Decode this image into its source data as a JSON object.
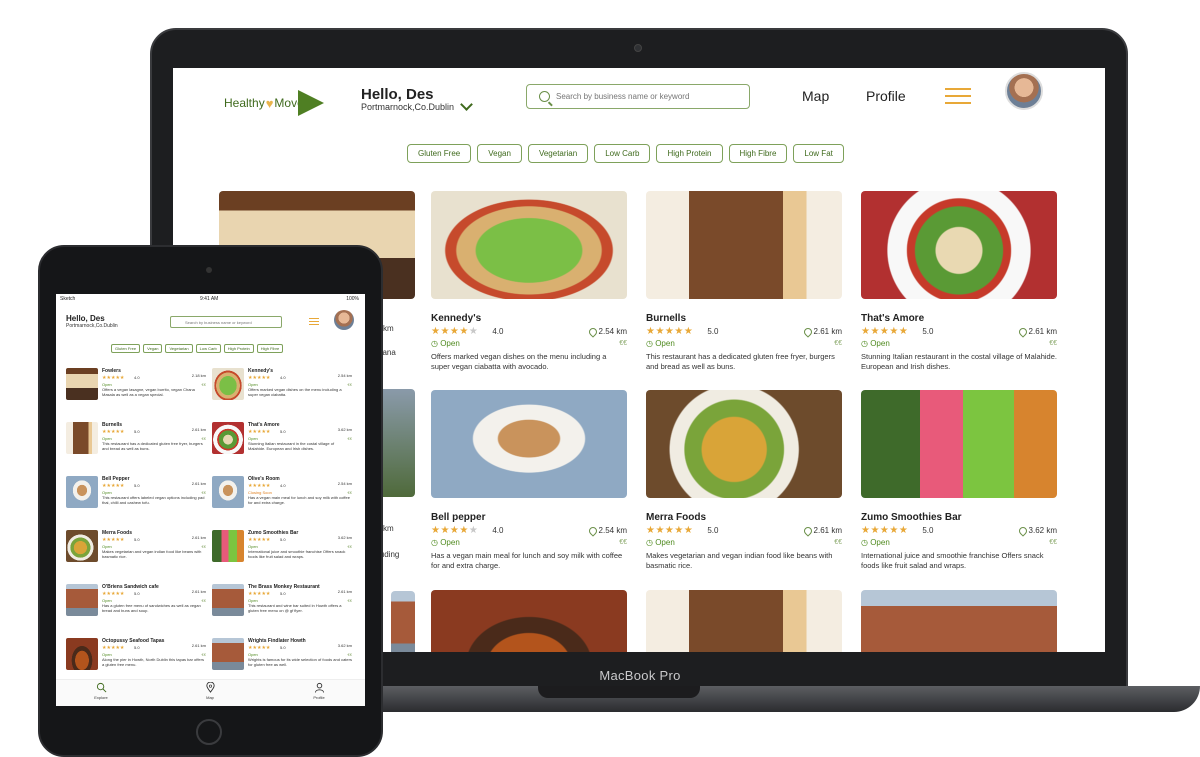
{
  "laptop": {
    "brand_label": "MacBook Pro",
    "app": {
      "logo_text_1": "Healthy",
      "logo_text_2": "Move",
      "greeting": "Hello, Des",
      "location": "Portmarnock,Co.Dublin",
      "search_placeholder": "Search by business name or keyword",
      "nav": [
        "Map",
        "Profile"
      ],
      "filters": [
        "Gluten Free",
        "Vegan",
        "Vegetarian",
        "Low Carb",
        "High Protein",
        "High Fibre",
        "Low Fat"
      ],
      "partial_left": [
        "km",
        "hana",
        "km",
        "luding"
      ],
      "cards": [
        {
          "name": "Kennedy's",
          "stars": 4,
          "rating": "4.0",
          "distance": "2.54 km",
          "status": "Open",
          "price": "€€",
          "desc": "Offers marked vegan dishes on the menu including a super vegan ciabatta with avocado.",
          "photo": "p-kennedy"
        },
        {
          "name": "Burnells",
          "stars": 5,
          "rating": "5.0",
          "distance": "2.61 km",
          "status": "Open",
          "price": "€€",
          "desc": "This restaurant has a dedicated gluten free fryer, burgers and bread as well as buns.",
          "photo": "p-burnells"
        },
        {
          "name": "That's Amore",
          "stars": 5,
          "rating": "5.0",
          "distance": "2.61 km",
          "status": "Open",
          "price": "€€",
          "desc": "Stunning Italian restaurant in the costal village of Malahide. European and Irish dishes.",
          "photo": "p-amore"
        },
        {
          "name": "Bell pepper",
          "stars": 4,
          "rating": "4.0",
          "distance": "2.54 km",
          "status": "Open",
          "price": "€€",
          "desc": "Has a vegan main meal for lunch and soy milk with coffee for and extra charge.",
          "photo": "p-bellpep"
        },
        {
          "name": "Merra Foods",
          "stars": 5,
          "rating": "5.0",
          "distance": "2.61 km",
          "status": "Open",
          "price": "€€",
          "desc": "Makes vegetarian and vegan indian food like beans with basmatic rice.",
          "photo": "p-merra"
        },
        {
          "name": "Zumo Smoothies Bar",
          "stars": 5,
          "rating": "5.0",
          "distance": "3.62 km",
          "status": "Open",
          "price": "€€",
          "desc": "International juice and smoothie franchise Offers snack foods like fruit salad and wraps.",
          "photo": "p-zumo"
        }
      ]
    }
  },
  "tablet": {
    "status_bar": {
      "carrier": "Sketch",
      "time": "9:41 AM",
      "battery": "100%"
    },
    "greeting": "Hello, Des",
    "location": "Portmarnock,Co.Dublin",
    "search_placeholder": "Search by business name or keyword",
    "filters": [
      "Gluten Free",
      "Vegan",
      "Vegetarian",
      "Low Carb",
      "High Protein",
      "High Fibre"
    ],
    "cards": [
      {
        "name": "Fowlers",
        "rating": "4.0",
        "distance": "2.18 km",
        "status": "Open",
        "price": "€€",
        "desc": "Offers a vegan lasagne, vegan burrito, vegan Chana Masala as well as a vegan special.",
        "photo": "p-fowlers"
      },
      {
        "name": "Kennedy's",
        "rating": "4.0",
        "distance": "2.54 km",
        "status": "Open",
        "price": "€€",
        "desc": "Offers marked vegan dishes on the menu including a super vegan ciabatta.",
        "photo": "p-kennedy"
      },
      {
        "name": "Burnells",
        "rating": "5.0",
        "distance": "2.61 km",
        "status": "Open",
        "price": "€€",
        "desc": "This restaurant has a dedicated gluten free fryer, burgers and bread as well as buns.",
        "photo": "p-burnells"
      },
      {
        "name": "That's Amore",
        "rating": "5.0",
        "distance": "3.62 km",
        "status": "Open",
        "price": "€€",
        "desc": "Stunning Italian restaurant in the costal village of Malahide. European and Irish dishes.",
        "photo": "p-amore"
      },
      {
        "name": "Bell Pepper",
        "rating": "5.0",
        "distance": "2.61 km",
        "status": "Open",
        "price": "€€",
        "desc": "This restaurant offers labeled vegan options including pad thai, chilli and cashew tofu.",
        "photo": "p-bellpep"
      },
      {
        "name": "Olive's Room",
        "rating": "4.0",
        "distance": "2.54 km",
        "status": "Closing Soon",
        "price": "€€",
        "desc": "Has a vegan main meal for lunch and soy milk with coffee for and extra charge.",
        "photo": "p-bellpep"
      },
      {
        "name": "Merra Foods",
        "rating": "5.0",
        "distance": "2.61 km",
        "status": "Open",
        "price": "€€",
        "desc": "Makes vegetarian and vegan indian food like beans with basmatic rice.",
        "photo": "p-merra"
      },
      {
        "name": "Zumo Smoothies Bar",
        "rating": "5.0",
        "distance": "3.62 km",
        "status": "Open",
        "price": "€€",
        "desc": "International juice and smoothie franchise Offers snack foods like fruit salad and wraps.",
        "photo": "p-zumo"
      },
      {
        "name": "O'Briens Sandwich cafe",
        "rating": "5.0",
        "distance": "2.61 km",
        "status": "Open",
        "price": "€€",
        "desc": "Has a gluten free menu of sandwiches as well as vegan bread and buns and soup.",
        "photo": "p-brass"
      },
      {
        "name": "The Brass Monkey Restaurant",
        "rating": "5.0",
        "distance": "2.61 km",
        "status": "Open",
        "price": "€€",
        "desc": "This restaurant and wine bar suited in Howth offers a gluten free menu on @ gf flyer.",
        "photo": "p-brass"
      },
      {
        "name": "Octopussy Seafood Tapas",
        "rating": "5.0",
        "distance": "2.61 km",
        "status": "Open",
        "price": "€€",
        "desc": "Along the pier in Howth, North Dublin this tapas bar offers a gluten free menu.",
        "photo": "p-octo"
      },
      {
        "name": "Wrights Findlater Howth",
        "rating": "5.0",
        "distance": "3.62 km",
        "status": "Open",
        "price": "€€",
        "desc": "Wrights is famous for its wide selection of foods and caters for gluten free as well.",
        "photo": "p-brass"
      }
    ],
    "tabbar": [
      "Explore",
      "Map",
      "Profile"
    ]
  }
}
